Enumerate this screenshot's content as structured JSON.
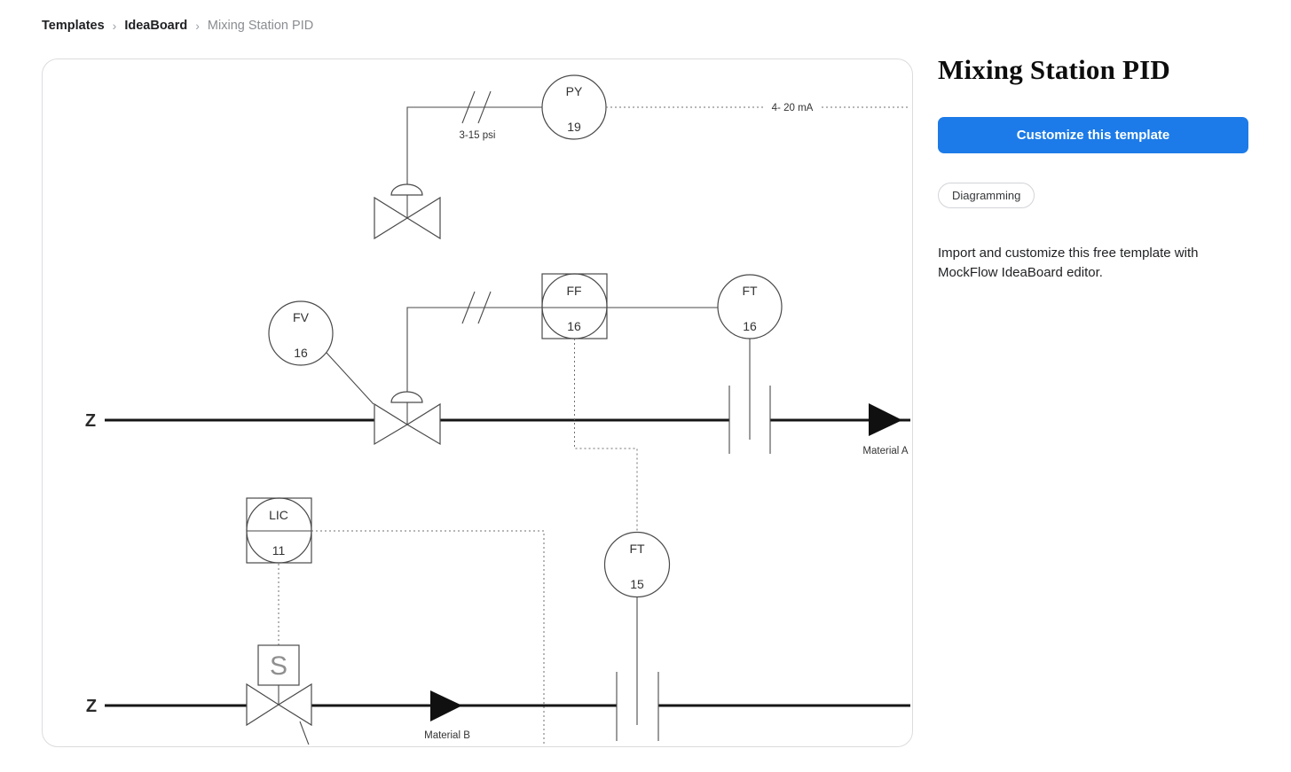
{
  "breadcrumb": {
    "items": [
      {
        "label": "Templates"
      },
      {
        "label": "IdeaBoard"
      },
      {
        "label": "Mixing Station PID"
      }
    ],
    "separator": "›"
  },
  "panel": {
    "title": "Mixing Station PID",
    "customize_button": "Customize this template",
    "category_tag": "Diagramming",
    "description": "Import and customize this free template with MockFlow IdeaBoard editor."
  },
  "colors": {
    "primary_button": "#1c7be8",
    "pipe_line": "#161616",
    "signal_line": "#4a4a4a"
  },
  "diagram": {
    "instruments": {
      "py19": {
        "tag": "PY",
        "number": "19"
      },
      "fv16": {
        "tag": "FV",
        "number": "16"
      },
      "ff16": {
        "tag": "FF",
        "number": "16"
      },
      "ft16": {
        "tag": "FT",
        "number": "16"
      },
      "ft15": {
        "tag": "FT",
        "number": "15"
      },
      "lic11": {
        "tag": "LIC",
        "number": "11"
      },
      "solenoid": {
        "tag": "S"
      }
    },
    "labels": {
      "pneumatic_range": "3-15 psi",
      "current_range": "4- 20 mA",
      "line_z_top": "Z",
      "line_z_bottom": "Z",
      "material_a": "Material A",
      "material_b": "Material B"
    }
  }
}
